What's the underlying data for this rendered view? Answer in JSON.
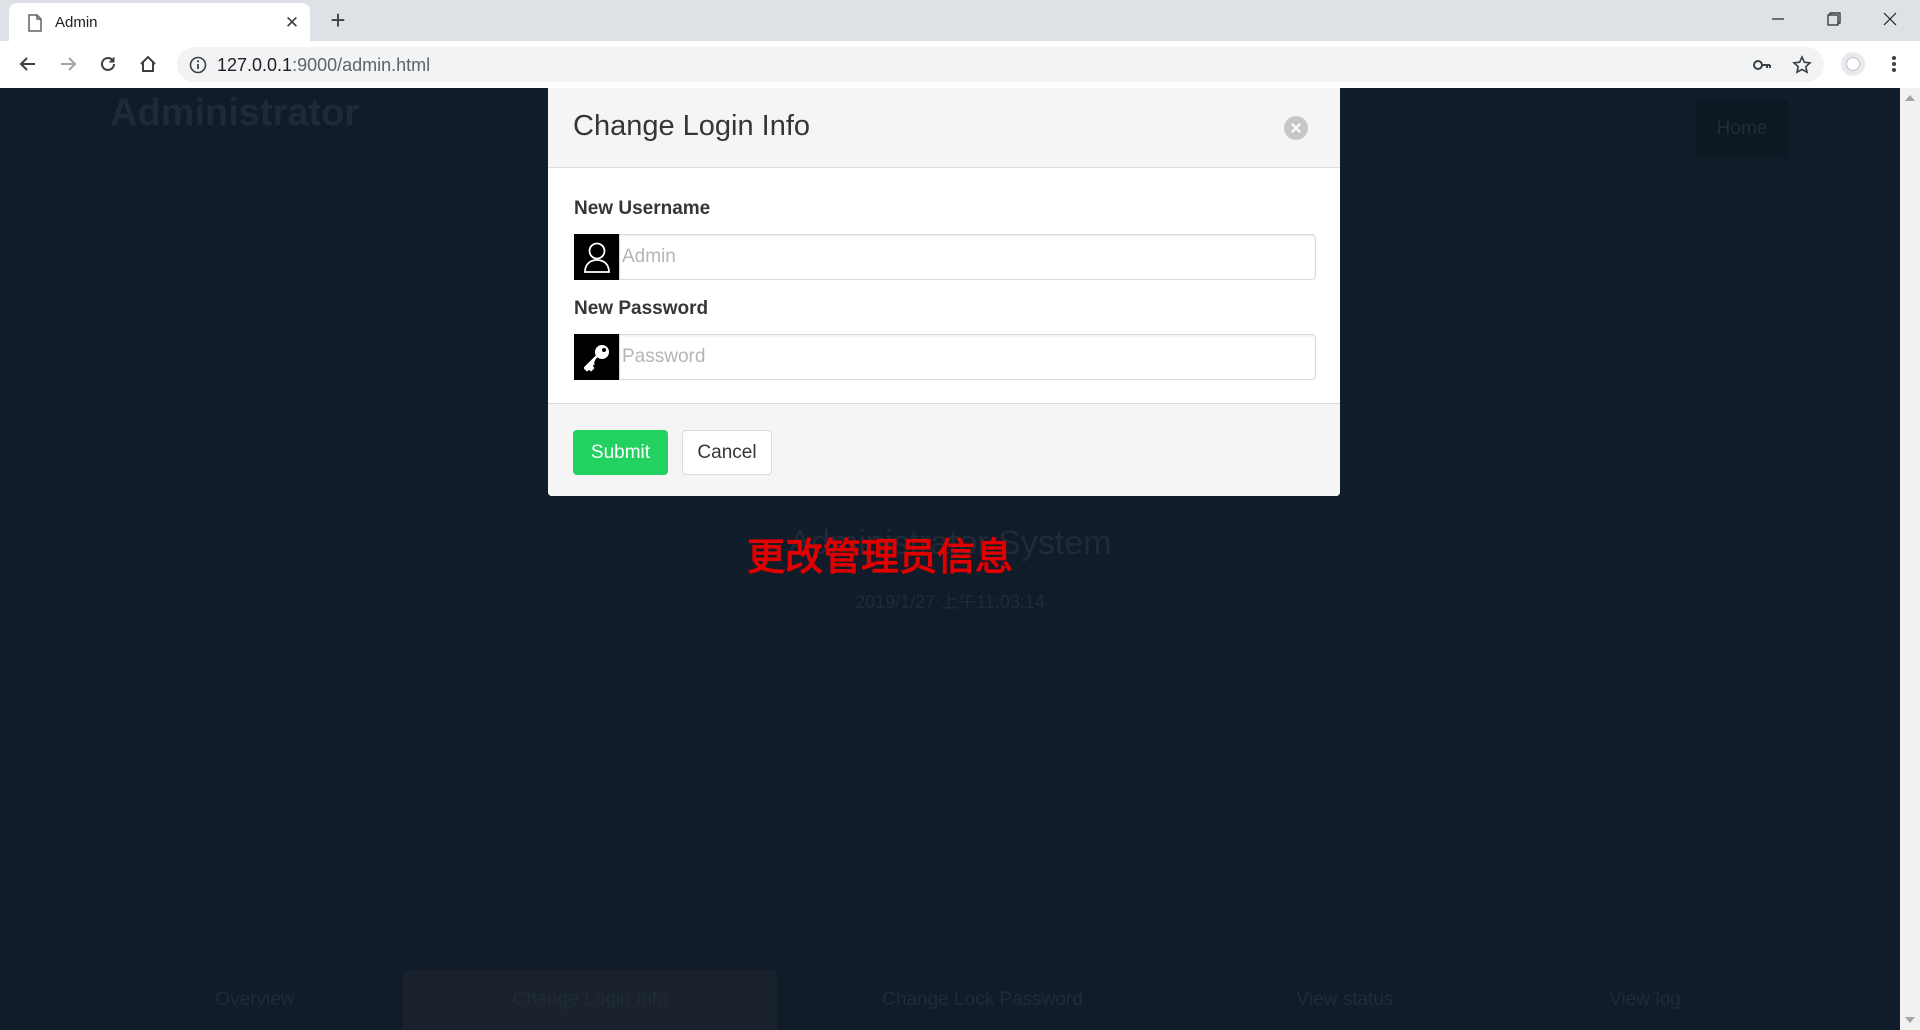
{
  "browser": {
    "tab_title": "Admin",
    "url_host": "127.0.0.1",
    "url_rest": ":9000/admin.html",
    "icons": [
      "page-icon",
      "close-icon",
      "plus-icon",
      "minimize-icon",
      "restore-icon",
      "back-icon",
      "forward-icon",
      "reload-icon",
      "home-icon",
      "info-icon",
      "key-icon",
      "star-icon",
      "profile-icon",
      "menu-icon"
    ]
  },
  "page": {
    "brand": "Administrator",
    "home_label": "Home",
    "hero_title": "Administrator System",
    "hero_time": "2019/1/27 上午11:03:14",
    "annotation": "更改管理员信息",
    "annotation_color": "#e00000",
    "bottom_nav": [
      {
        "label": "Overview"
      },
      {
        "label": "Change Login Info",
        "active": true
      },
      {
        "label": "Change Lock Password"
      },
      {
        "label": "View status"
      },
      {
        "label": "View log"
      }
    ]
  },
  "modal": {
    "title": "Change Login Info",
    "username_label": "New Username",
    "username_placeholder": "Admin",
    "username_icon": "user-icon",
    "password_label": "New Password",
    "password_placeholder": "Password",
    "password_icon": "key-icon",
    "submit_label": "Submit",
    "submit_color": "#23d160",
    "cancel_label": "Cancel"
  }
}
